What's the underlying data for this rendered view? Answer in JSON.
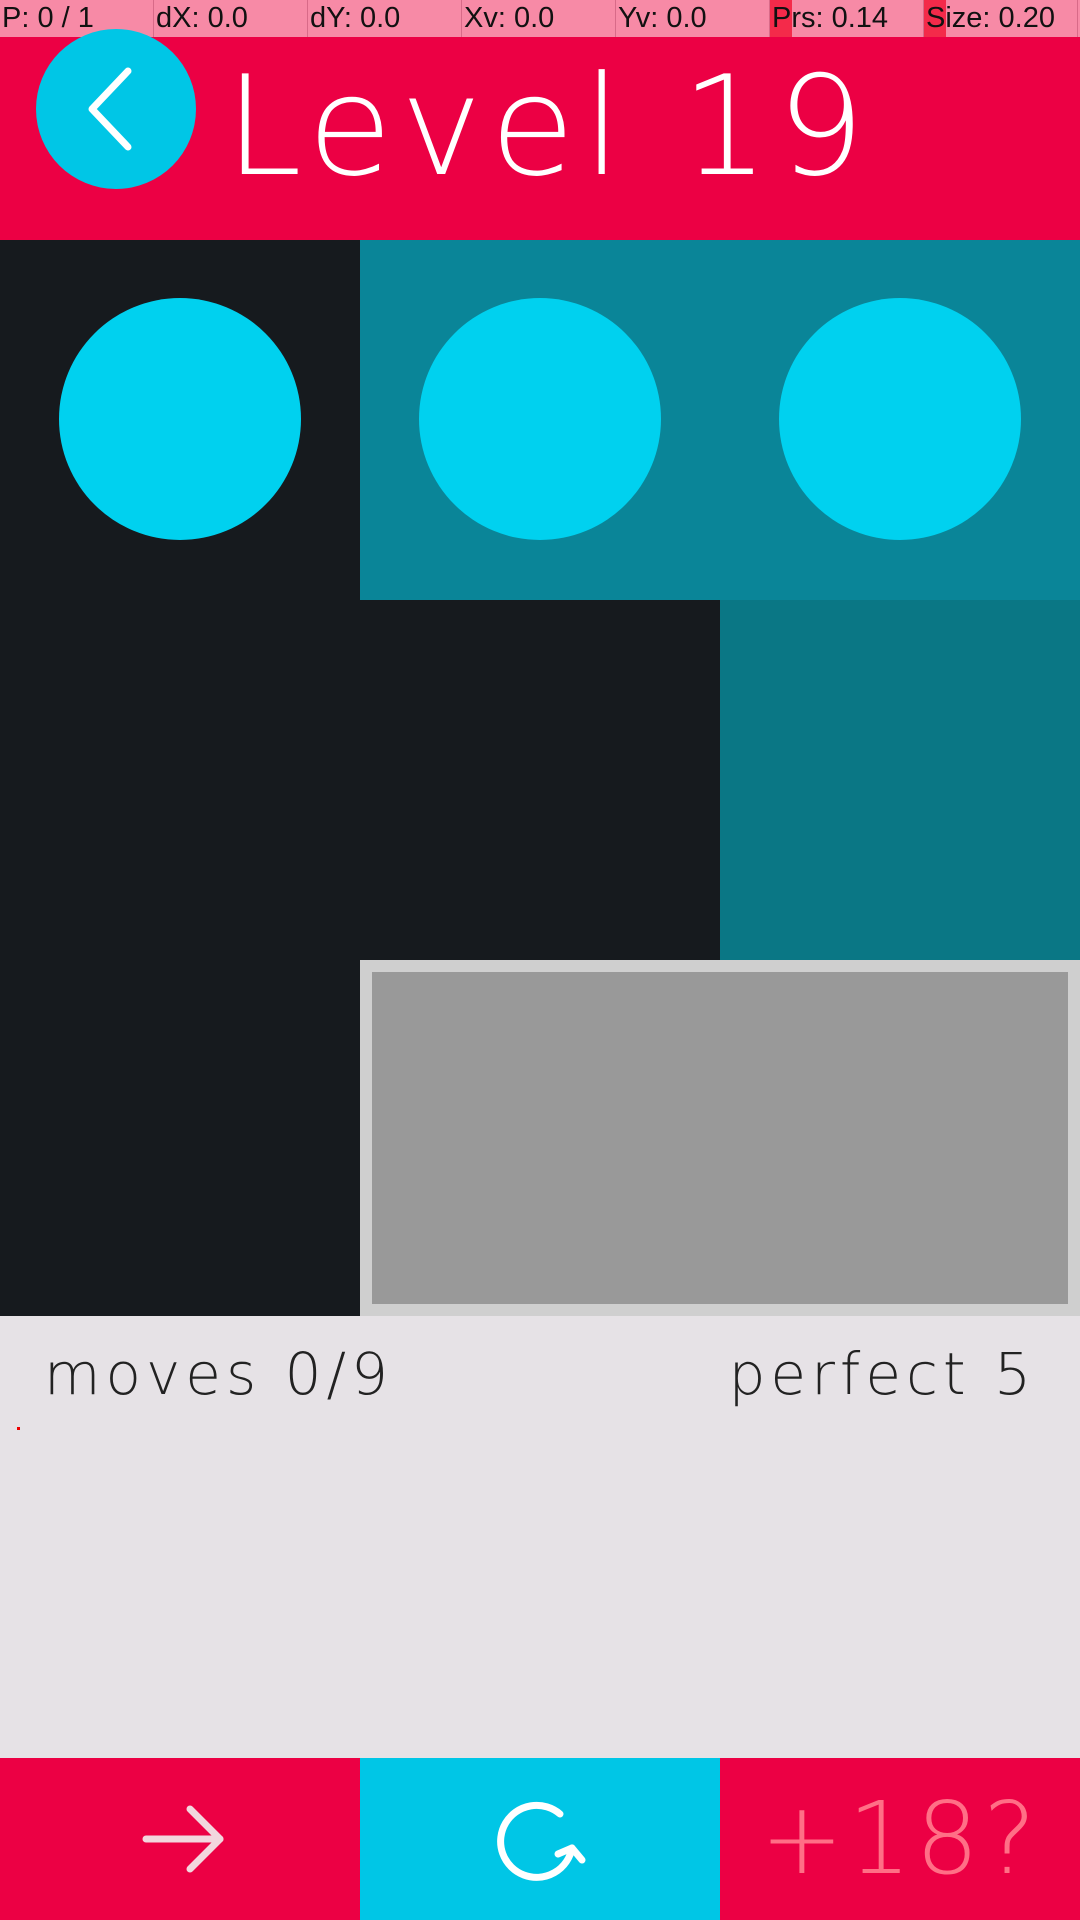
{
  "debug": {
    "pointer": "P: 0 / 1",
    "dx": "dX: 0.0",
    "dy": "dY: 0.0",
    "xv": "Xv: 0.0",
    "yv": "Yv: 0.0",
    "prs": "Prs: 0.14",
    "size": "Size: 0.20"
  },
  "header": {
    "title": "Level 19",
    "back_icon": "chevron-left-icon"
  },
  "board": {
    "colors": {
      "dark": "#161a1e",
      "teal_light": "#0a8598",
      "teal_dark": "#0a7785",
      "circle": "#00d1ef",
      "goal": "#999999",
      "goal_border": "#cfcfcf"
    }
  },
  "stats": {
    "moves": "moves 0/9",
    "perfect": "perfect 5"
  },
  "bottom_bar": {
    "next_icon": "arrow-right-icon",
    "restart_icon": "restart-icon",
    "hint_label": "+18?",
    "colors": {
      "primary": "#ec0044",
      "accent": "#00c6e6"
    }
  }
}
